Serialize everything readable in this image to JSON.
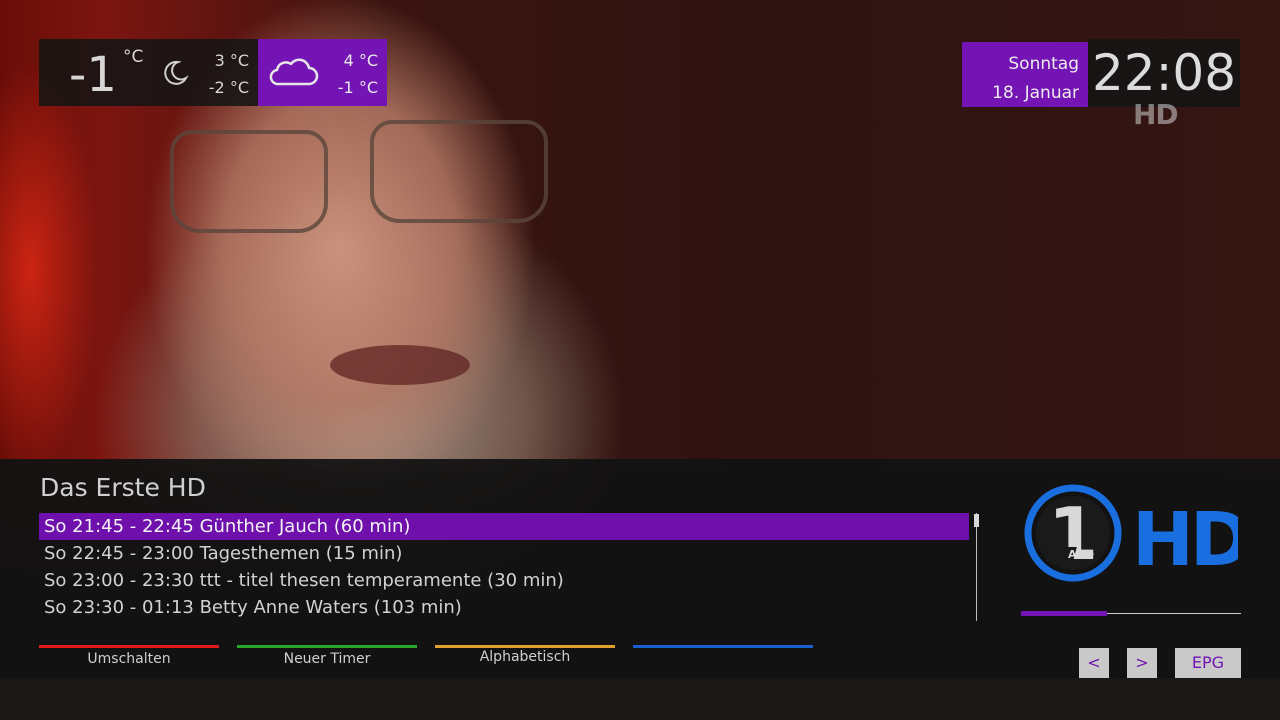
{
  "weather": {
    "current_temp": "-1",
    "current_unit": "°C",
    "night_icon": "moon-icon",
    "today_high": "3 °C",
    "today_low": "-2 °C",
    "forecast_icon": "cloud-icon",
    "forecast_high": "4 °C",
    "forecast_low": "-1 °C"
  },
  "clock": {
    "weekday": "Sonntag",
    "date": "18. Januar",
    "time": "22:08"
  },
  "watermark": "HD",
  "epg": {
    "channel": "Das Erste HD",
    "programs": [
      {
        "text": "So 21:45 - 22:45 Günther Jauch (60 min)"
      },
      {
        "text": "So 22:45 - 23:00 Tagesthemen (15 min)"
      },
      {
        "text": "So 23:00 - 23:30 ttt - titel thesen temperamente (30 min)"
      },
      {
        "text": "So 23:30 - 01:13 Betty Anne Waters (103 min)"
      }
    ],
    "selected_index": 0,
    "progress_fraction": 0.39,
    "logo": {
      "number": "1",
      "sub": "ARD",
      "hd": "HD"
    }
  },
  "keys": {
    "red": {
      "label": "Umschalten",
      "color": "#e01a1a"
    },
    "green": {
      "label": "Neuer Timer",
      "color": "#2aa52a"
    },
    "yellow": {
      "label": "Alphabetisch",
      "color": "#e0a030"
    },
    "blue": {
      "label": "",
      "color": "#1a5fd0"
    }
  },
  "nav": {
    "prev": "<",
    "next": ">",
    "epg": "EPG"
  },
  "colors": {
    "accent": "#7414b4",
    "logo_blue": "#1a6fe0"
  }
}
